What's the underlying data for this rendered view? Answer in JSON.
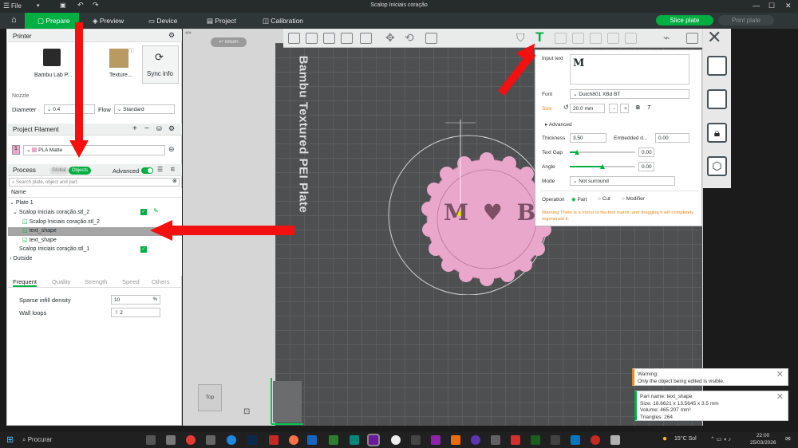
{
  "window": {
    "title": "Scalop Iniciais coração",
    "menu_file": "File"
  },
  "tabs": [
    {
      "label": "Prepare"
    },
    {
      "label": "Preview"
    },
    {
      "label": "Device"
    },
    {
      "label": "Project"
    },
    {
      "label": "Calibration"
    }
  ],
  "actions": {
    "slice": "Slice plate",
    "print": "Print plate"
  },
  "printer": {
    "header": "Printer",
    "printer_name": "Bambu Lab P...",
    "plate_name": "Texture...",
    "sync": "Sync info",
    "nozzle_label": "Nozzle",
    "diameter_label": "Diameter",
    "diameter_value": "0.4",
    "flow_label": "Flow",
    "flow_value": "Standard"
  },
  "filament": {
    "header": "Project Filament",
    "index": "1",
    "name": "PLA Matte"
  },
  "process": {
    "header": "Process",
    "global": "Global",
    "objects": "Objects",
    "advanced": "Advanced",
    "search_placeholder": "Search plate, object and part."
  },
  "tree": {
    "col_name": "Name",
    "items": [
      "Plate 1",
      "Scalop Iniciais coração.stl_2",
      "Scalop Iniciais coração.stl_2",
      "text_shape",
      "text_shape",
      "Scalop Iniciais coração.stl_1",
      "Outside"
    ]
  },
  "settings_tabs": [
    "Frequent",
    "Quality",
    "Strength",
    "Speed",
    "Others"
  ],
  "settings": {
    "sparse_label": "Sparse infill density",
    "sparse_value": "10",
    "sparse_unit": "%",
    "wall_label": "Wall loops",
    "wall_value": "2"
  },
  "viewport": {
    "return": "return",
    "plate_text": "Bambu Textured PEI Plate",
    "view_label": "Top",
    "letters": "M ♥ B"
  },
  "text_panel": {
    "input_label": "Input text",
    "input_value": "M",
    "font_label": "Font",
    "font_value": "Dutch801 XBd BT",
    "size_label": "Size",
    "size_value": "20.0 mm",
    "bold": "B",
    "italic": "T",
    "advanced": "Advanced",
    "thickness_label": "Thickness",
    "thickness_value": "3.50",
    "embedded_label": "Embedded d...",
    "embedded_value": "0.00",
    "gap_label": "Text Gap",
    "gap_value": "0.00",
    "angle_label": "Angle",
    "angle_value": "0.00",
    "mode_label": "Mode",
    "mode_value": "Not surround",
    "operation_label": "Operation",
    "op_part": "Part",
    "op_cut": "Cut",
    "op_modifier": "Modifier",
    "warning": "Warning:There is a mirror in the text matrix, and dragging it will completely regenerate it."
  },
  "notifications": {
    "warn_title": "Warning:",
    "warn_body": "Only the object being edited is visible.",
    "info_line1": "Part name: text_shape",
    "info_line2": "Size: 18.6621 x 13.5645 x 3.5 mm",
    "info_line3": "Volume: 465.207 mm³",
    "info_line4": "Triangles: 264"
  },
  "taskbar": {
    "search": "Procurar",
    "weather": "15°C  Sol",
    "time": "22:00",
    "date": "25/03/2026"
  },
  "colors": {
    "accent": "#00ae42",
    "arrow": "#f21010",
    "plate_pink": "#e8a7cb"
  }
}
